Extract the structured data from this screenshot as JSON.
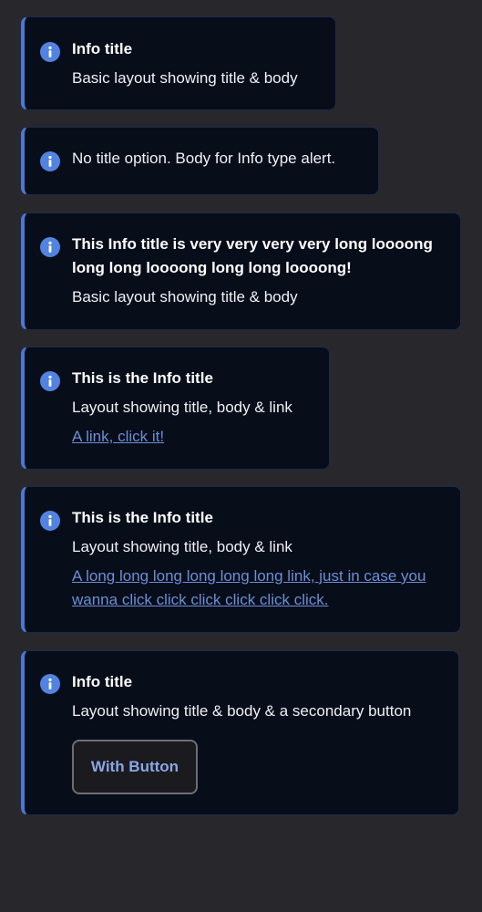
{
  "colors": {
    "page_background": "#28282c",
    "alert_background": "#080d1a",
    "accent": "#4a78d4",
    "icon": "#5283e0",
    "link": "#6b8fd6"
  },
  "alerts": [
    {
      "icon": "info-icon",
      "title": "Info title",
      "body": "Basic layout showing title & body"
    },
    {
      "icon": "info-icon",
      "body": "No title option. Body for Info type alert."
    },
    {
      "icon": "info-icon",
      "title": "This Info title is very very very very  long loooong long long loooong long long loooong!",
      "body": "Basic layout showing title & body"
    },
    {
      "icon": "info-icon",
      "title": "This is the Info title",
      "body": "Layout showing title, body & link",
      "link": "A link, click it!"
    },
    {
      "icon": "info-icon",
      "title": "This is the Info title",
      "body": "Layout showing title, body & link",
      "link": "A long long long long long long link, just in case you wanna click click click click click click."
    },
    {
      "icon": "info-icon",
      "title": "Info title",
      "body": "Layout showing title & body & a secondary button",
      "button": "With Button"
    }
  ]
}
